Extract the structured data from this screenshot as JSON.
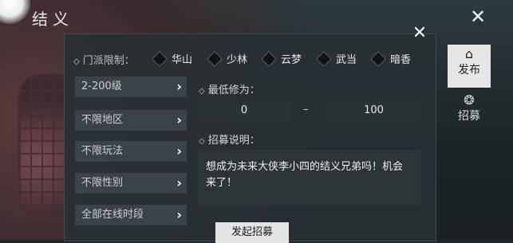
{
  "header": {
    "title": "结义"
  },
  "filters": {
    "sect_label": "门派限制：",
    "sect_options": [
      "华山",
      "少林",
      "云梦",
      "武当",
      "暗香"
    ],
    "dropdowns": [
      "2-200级",
      "不限地区",
      "不限玩法",
      "不限性别",
      "全部在线时段"
    ]
  },
  "level": {
    "label": "最低修为：",
    "min": "0",
    "separator": "–",
    "max": "100"
  },
  "recruit": {
    "label": "招募说明：",
    "text": "想成为未来大侠李小四的结义兄弟吗！机会来了！"
  },
  "actions": {
    "submit_label": "发起招募"
  },
  "side_tabs": [
    {
      "label": "发布",
      "icon": "pavilion-icon"
    },
    {
      "label": "招募",
      "icon": "swirl-icon"
    }
  ]
}
